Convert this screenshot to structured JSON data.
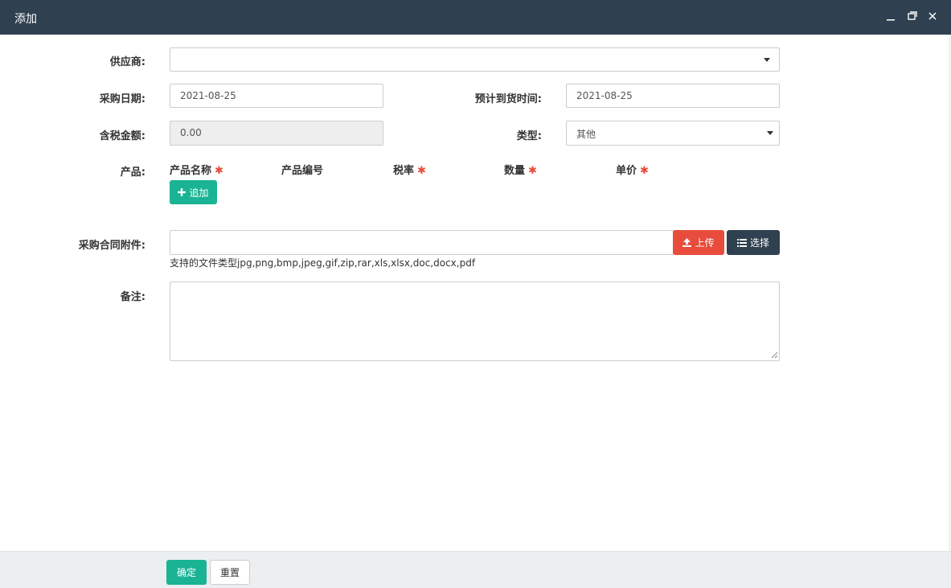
{
  "window": {
    "title": "添加",
    "controls": [
      "minimize-icon",
      "maximize-icon",
      "close-icon"
    ]
  },
  "form": {
    "supplier": {
      "label": "供应商:",
      "value": ""
    },
    "purchase_date": {
      "label": "采购日期:",
      "value": "2021-08-25"
    },
    "expected_date": {
      "label": "预计到货时间:",
      "value": "2021-08-25"
    },
    "tax_amount": {
      "label": "含税金额:",
      "value": "0.00"
    },
    "type": {
      "label": "类型:",
      "value": "其他"
    },
    "products": {
      "label": "产品:",
      "columns": [
        {
          "label": "产品名称",
          "required": true
        },
        {
          "label": "产品编号",
          "required": false
        },
        {
          "label": "税率",
          "required": true
        },
        {
          "label": "数量",
          "required": true
        },
        {
          "label": "单价",
          "required": true
        }
      ],
      "add_label": "追加"
    },
    "attachment": {
      "label": "采购合同附件:",
      "value": "",
      "upload_label": "上传",
      "select_label": "选择",
      "hint": "支持的文件类型jpg,png,bmp,jpeg,gif,zip,rar,xls,xlsx,doc,docx,pdf"
    },
    "remark": {
      "label": "备注:",
      "value": ""
    }
  },
  "footer": {
    "confirm_label": "确定",
    "reset_label": "重置"
  },
  "colors": {
    "titlebar": "#2f4050",
    "primary": "#1ab394",
    "danger": "#e74c3c",
    "required_star": "#e74c3c"
  }
}
